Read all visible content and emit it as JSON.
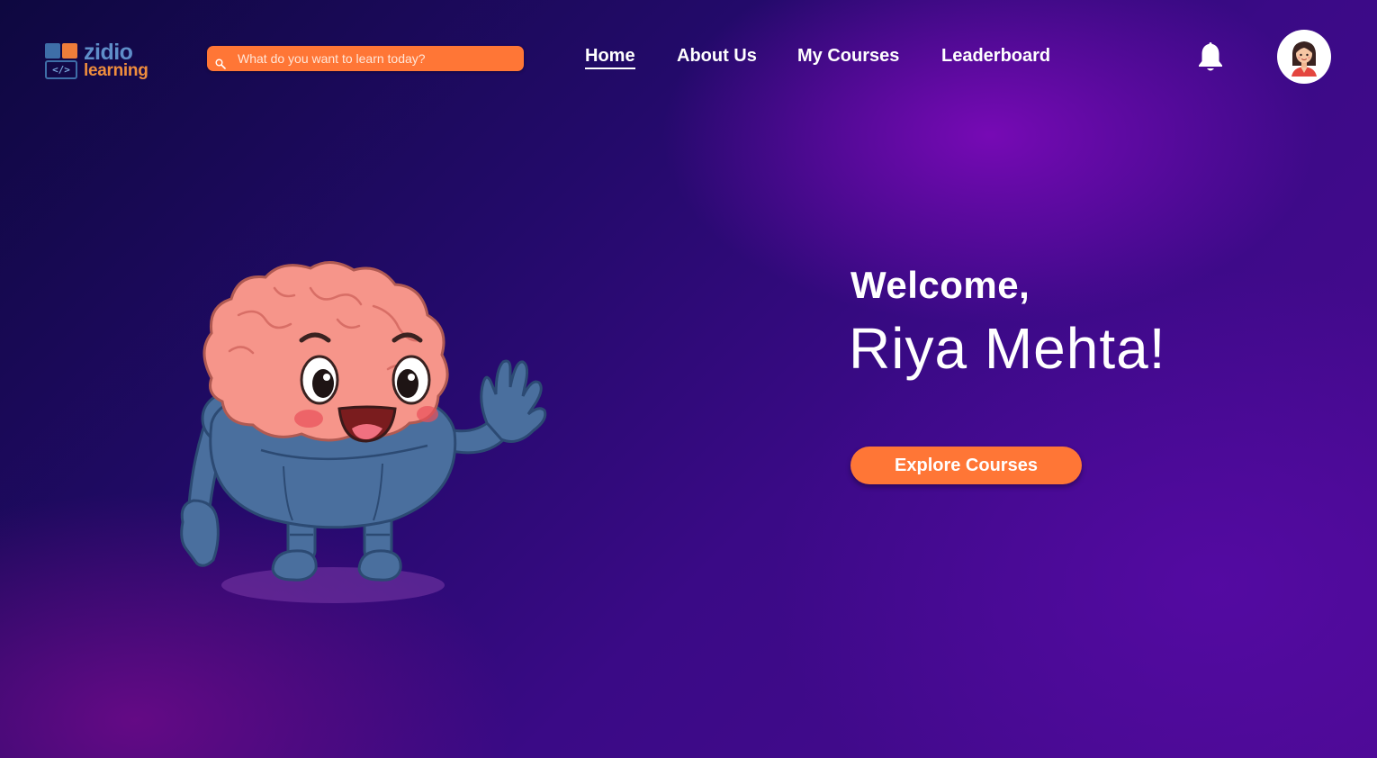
{
  "brand": {
    "line1": "zidio",
    "line2": "learning",
    "code_glyph": "</>",
    "colors": {
      "blue": "#3e6ea8",
      "orange": "#ef7d3a"
    }
  },
  "search": {
    "placeholder": "What do you want to learn today?",
    "value": "",
    "icon": "search-icon"
  },
  "nav": {
    "items": [
      {
        "label": "Home",
        "active": true
      },
      {
        "label": "About Us",
        "active": false
      },
      {
        "label": "My Courses",
        "active": false
      },
      {
        "label": "Leaderboard",
        "active": false
      }
    ]
  },
  "header_icons": {
    "notifications": "bell-icon",
    "profile": "avatar"
  },
  "hero": {
    "greeting": "Welcome,",
    "user_name": "Riya Mehta!",
    "cta_label": "Explore Courses",
    "illustration": "brain-robot-mascot"
  },
  "colors": {
    "accent": "#ff7636",
    "text": "#ffffff",
    "bg_dark": "#0e0840",
    "bg_purple": "#4b0a92"
  }
}
